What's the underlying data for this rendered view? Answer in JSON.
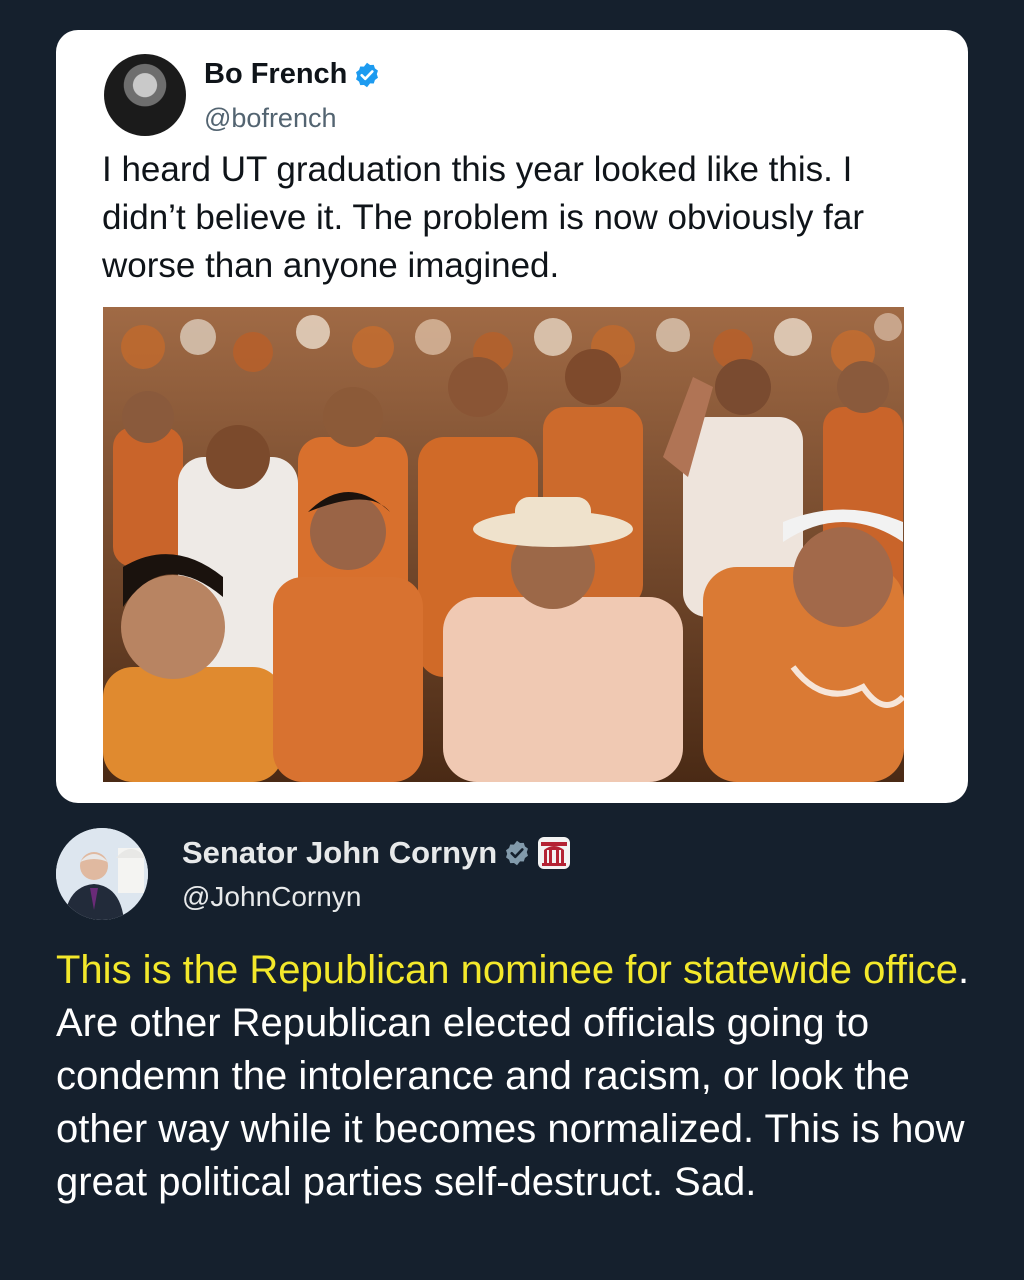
{
  "quoted_tweet": {
    "author_name": "Bo French",
    "handle": "@bofrench",
    "text": "I heard UT graduation this year looked like this. I didn’t believe it. The problem is now obviously far worse than anyone imagined.",
    "avatar_icon": "profile-photo",
    "verified_icon": "verified-badge-icon",
    "media": "photo-crowd"
  },
  "reply_tweet": {
    "author_name": "Senator John Cornyn",
    "handle": "@JohnCornyn",
    "highlighted_text": "This is the Republican nominee for statewide office",
    "text_rest": ". Are other Republican elected officials going to condemn the intolerance and racism, or look the other way while it becomes normalized.  This is how great political parties self-destruct.  Sad.",
    "avatar_icon": "profile-photo",
    "verified_icon": "verified-badge-icon",
    "affiliation_icon": "us-senate-badge-icon"
  },
  "colors": {
    "background": "#15202d",
    "card": "#ffffff",
    "highlight": "#f3e82b",
    "verified": "#1d9bf0"
  }
}
